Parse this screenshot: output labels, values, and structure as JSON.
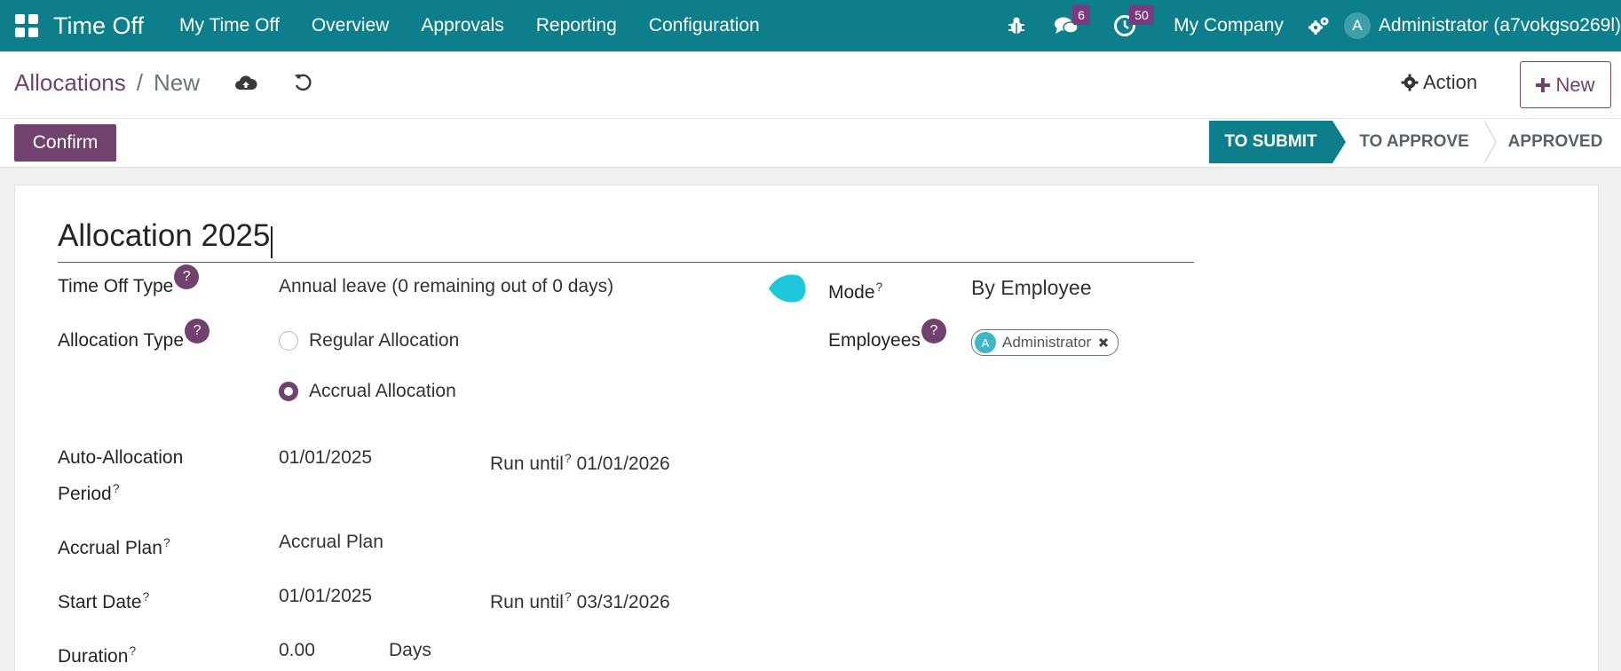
{
  "navbar": {
    "app_name": "Time Off",
    "menu": [
      "My Time Off",
      "Overview",
      "Approvals",
      "Reporting",
      "Configuration"
    ],
    "messages_count": "6",
    "activities_count": "50",
    "company": "My Company",
    "user_initial": "A",
    "user_name": "Administrator (a7vokgso269l)"
  },
  "breadcrumb": {
    "parent": "Allocations",
    "separator": "/",
    "current": "New"
  },
  "control": {
    "action_label": "Action",
    "new_label": "New"
  },
  "statusbar": {
    "confirm_label": "Confirm",
    "stages": [
      "TO SUBMIT",
      "TO APPROVE",
      "APPROVED"
    ],
    "active_stage": "TO SUBMIT"
  },
  "form": {
    "title": "Allocation 2025",
    "time_off_type_label": "Time Off Type",
    "time_off_type_value": "Annual leave (0 remaining out of 0 days)",
    "allocation_type_label": "Allocation Type",
    "allocation_type_options": [
      "Regular Allocation",
      "Accrual Allocation"
    ],
    "allocation_type_selected": "Accrual Allocation",
    "mode_label": "Mode",
    "mode_value": "By Employee",
    "employees_label": "Employees",
    "employee_tag": "Administrator",
    "employee_tag_initial": "A",
    "auto_alloc_label_1": "Auto-Allocation",
    "auto_alloc_label_2": "Period",
    "auto_alloc_start": "01/01/2025",
    "run_until_label": "Run until",
    "auto_alloc_run_until": "01/01/2026",
    "accrual_plan_label": "Accrual Plan",
    "accrual_plan_value": "Accrual Plan",
    "start_date_label": "Start Date",
    "start_date_value": "01/01/2025",
    "start_run_until": "03/31/2026",
    "duration_label": "Duration",
    "duration_value": "0.00",
    "duration_unit": "Days",
    "help_symbol": "?"
  },
  "colors": {
    "navbar": "#0c7f8a",
    "primary": "#71426e",
    "badge": "#7b3a80",
    "blob": "#1ec7d9"
  },
  "icons": [
    "apps-grid-icon",
    "bug-icon",
    "chat-icon",
    "clock-icon",
    "settings-gears-icon",
    "cloud-upload-icon",
    "undo-icon",
    "gear-icon",
    "plus-icon",
    "close-icon"
  ]
}
